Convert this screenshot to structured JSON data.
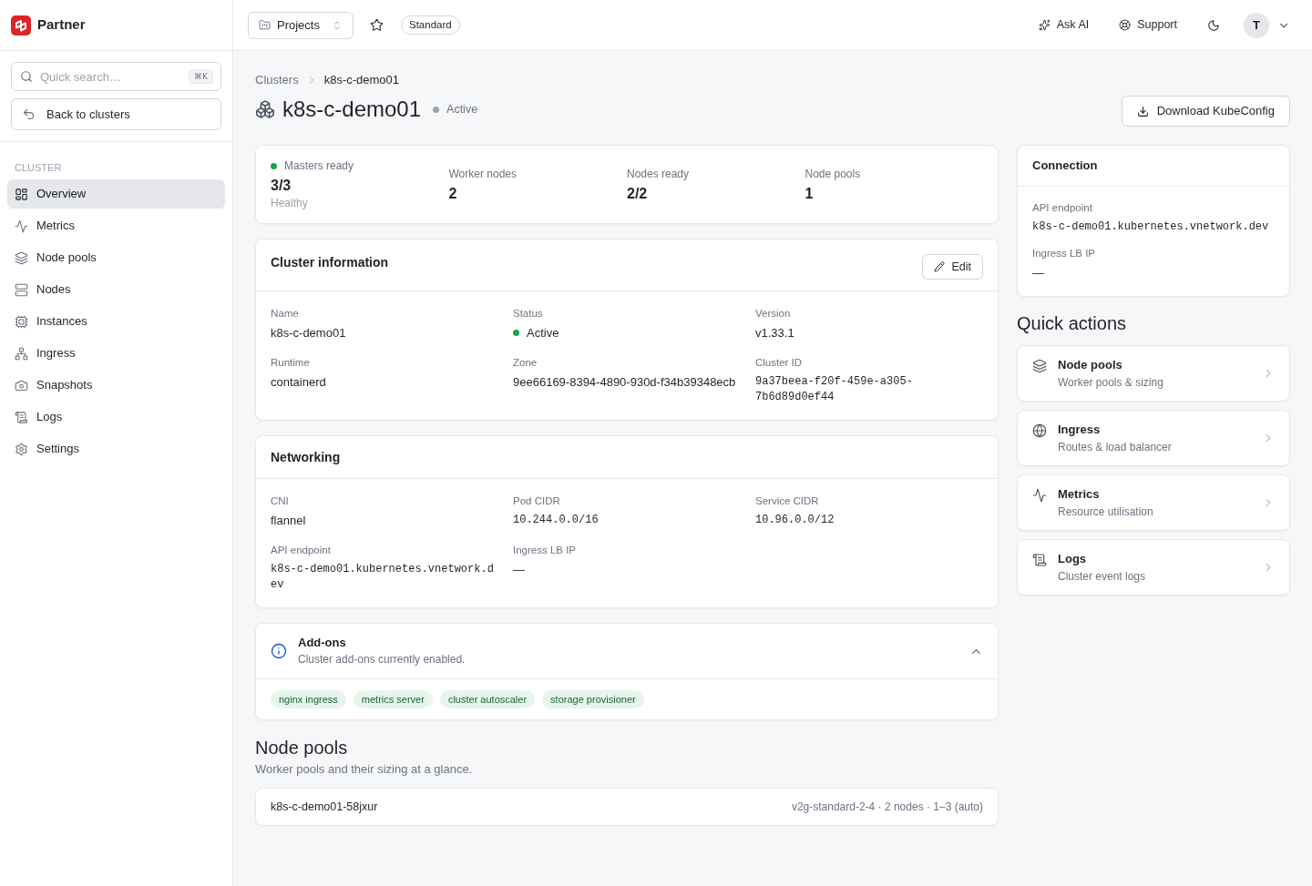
{
  "sidebar": {
    "brand": "Partner",
    "search": {
      "placeholder": "Quick search…",
      "shortcut": "⌘K"
    },
    "back_button": "Back to clusters",
    "section_label": "CLUSTER",
    "items": [
      {
        "label": "Overview",
        "selected": true
      },
      {
        "label": "Metrics",
        "selected": false
      },
      {
        "label": "Node pools",
        "selected": false
      },
      {
        "label": "Nodes",
        "selected": false
      },
      {
        "label": "Instances",
        "selected": false
      },
      {
        "label": "Ingress",
        "selected": false
      },
      {
        "label": "Snapshots",
        "selected": false
      },
      {
        "label": "Logs",
        "selected": false
      },
      {
        "label": "Settings",
        "selected": false
      }
    ]
  },
  "topbar": {
    "project_selector": "Projects",
    "plan_badge": "Standard",
    "ask_ai": "Ask AI",
    "support": "Support",
    "avatar": "T"
  },
  "breadcrumb": [
    "Clusters",
    "k8s-c-demo01"
  ],
  "header": {
    "title": "k8s-c-demo01",
    "status": {
      "label": "Active",
      "color": "#9ca3af"
    },
    "download_button": "Download KubeConfig"
  },
  "stats": [
    {
      "label": "Masters ready",
      "value": "3/3",
      "note": "Healthy",
      "color": "#16a34a"
    },
    {
      "label": "Worker nodes",
      "value": "2"
    },
    {
      "label": "Nodes ready",
      "value": "2/2"
    },
    {
      "label": "Node pools",
      "value": "1"
    }
  ],
  "cluster_information": {
    "title": "Cluster information",
    "edit_button": "Edit",
    "fields": [
      {
        "label": "Name",
        "value": "k8s-c-demo01",
        "kind": "text"
      },
      {
        "label": "Status",
        "value": "Active",
        "kind": "status",
        "color": "#16a34a"
      },
      {
        "label": "Version",
        "value": "v1.33.1",
        "kind": "text"
      },
      {
        "label": "Runtime",
        "value": "containerd",
        "kind": "text"
      },
      {
        "label": "Zone",
        "value": "9ee66169-8394-4890-930d-f34b39348ecb",
        "kind": "text"
      },
      {
        "label": "Cluster ID",
        "value": "9a37beea-f20f-459e-a305-7b6d89d0ef44",
        "kind": "mono"
      }
    ]
  },
  "networking": {
    "title": "Networking",
    "fields": [
      {
        "label": "CNI",
        "value": "flannel",
        "kind": "text"
      },
      {
        "label": "Pod CIDR",
        "value": "10.244.0.0/16",
        "kind": "mono"
      },
      {
        "label": "Service CIDR",
        "value": "10.96.0.0/12",
        "kind": "mono"
      },
      {
        "label": "API endpoint",
        "value": "k8s-c-demo01.kubernetes.vnetwork.dev",
        "kind": "url"
      },
      {
        "label": "Ingress LB IP",
        "value": "—",
        "kind": "text"
      }
    ]
  },
  "addons": {
    "title": "Add-ons",
    "subtitle": "Cluster add-ons currently enabled.",
    "expanded": true,
    "tags": [
      "nginx ingress",
      "metrics server",
      "cluster autoscaler",
      "storage provisioner"
    ]
  },
  "node_pools": {
    "title": "Node pools",
    "subtitle": "Worker pools and their sizing at a glance.",
    "rows": [
      {
        "name": "k8s-c-demo01-58jxur",
        "details": "v2g-standard-2-4 · 2 nodes · 1–3 (auto)"
      }
    ]
  },
  "connection": {
    "title": "Connection",
    "fields": [
      {
        "label": "API endpoint",
        "value": "k8s-c-demo01.kubernetes.vnetwork.dev",
        "kind": "url"
      },
      {
        "label": "Ingress LB IP",
        "value": "—",
        "kind": "text"
      }
    ]
  },
  "quick_actions": {
    "title": "Quick actions",
    "items": [
      {
        "title": "Node pools",
        "subtitle": "Worker pools & sizing"
      },
      {
        "title": "Ingress",
        "subtitle": "Routes & load balancer"
      },
      {
        "title": "Metrics",
        "subtitle": "Resource utilisation"
      },
      {
        "title": "Logs",
        "subtitle": "Cluster event logs"
      }
    ]
  }
}
